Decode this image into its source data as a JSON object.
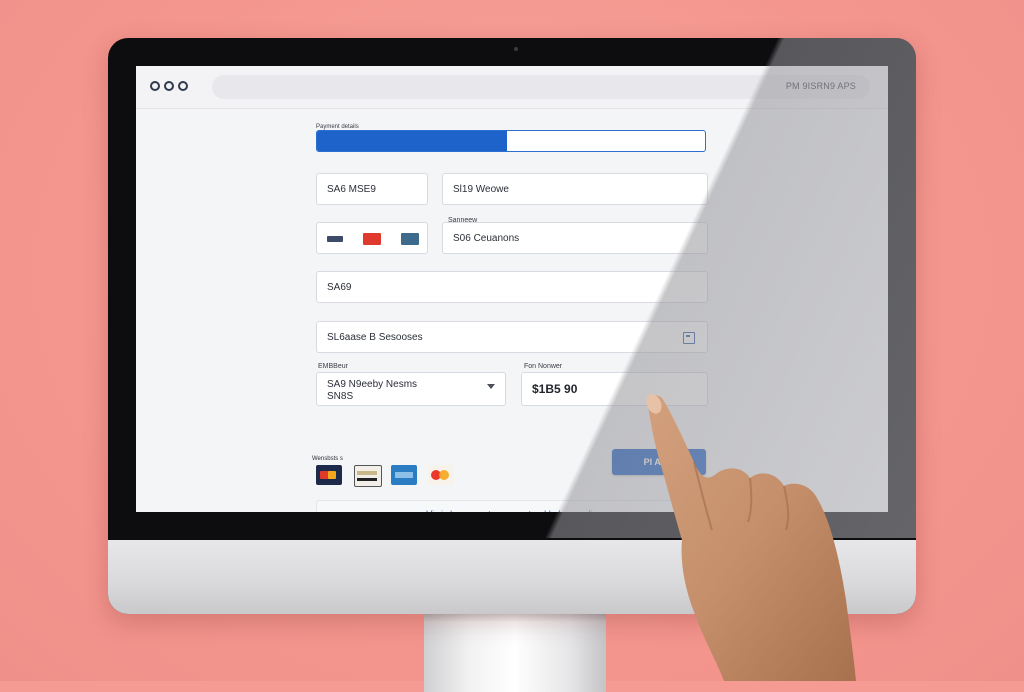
{
  "browser": {
    "url": "PM 9ISRN9 APS"
  },
  "form": {
    "progress_label": "Payment details",
    "progress_percent": 0.49,
    "field_1": "SA6 MSE9",
    "field_2": "Sl19 Weowe",
    "field_3_label": "Sanneew",
    "field_4": "S06 Ceuanons",
    "field_5": "SA69",
    "field_6": "SL6aase B Sesooses",
    "select_label": "EMBBeur",
    "select_line_1": "SA9 N9eeby Nesms",
    "select_line_2": "SN8S",
    "amount_label": "Fon Nonwer",
    "amount_value": "$1B5 90",
    "cards_label": "Wensbsts s",
    "pay_button_label": "PI A3 ir",
    "notice_text": "Vi cis bereennet s asessetned bsl x ecsolie"
  },
  "colors": {
    "accent": "#1e60c4",
    "background": "#f59b93",
    "screen": "#f4f5f7"
  },
  "icons": [
    "window-control-icon",
    "card-brand-icon",
    "calendar-icon",
    "chevron-down-icon"
  ]
}
